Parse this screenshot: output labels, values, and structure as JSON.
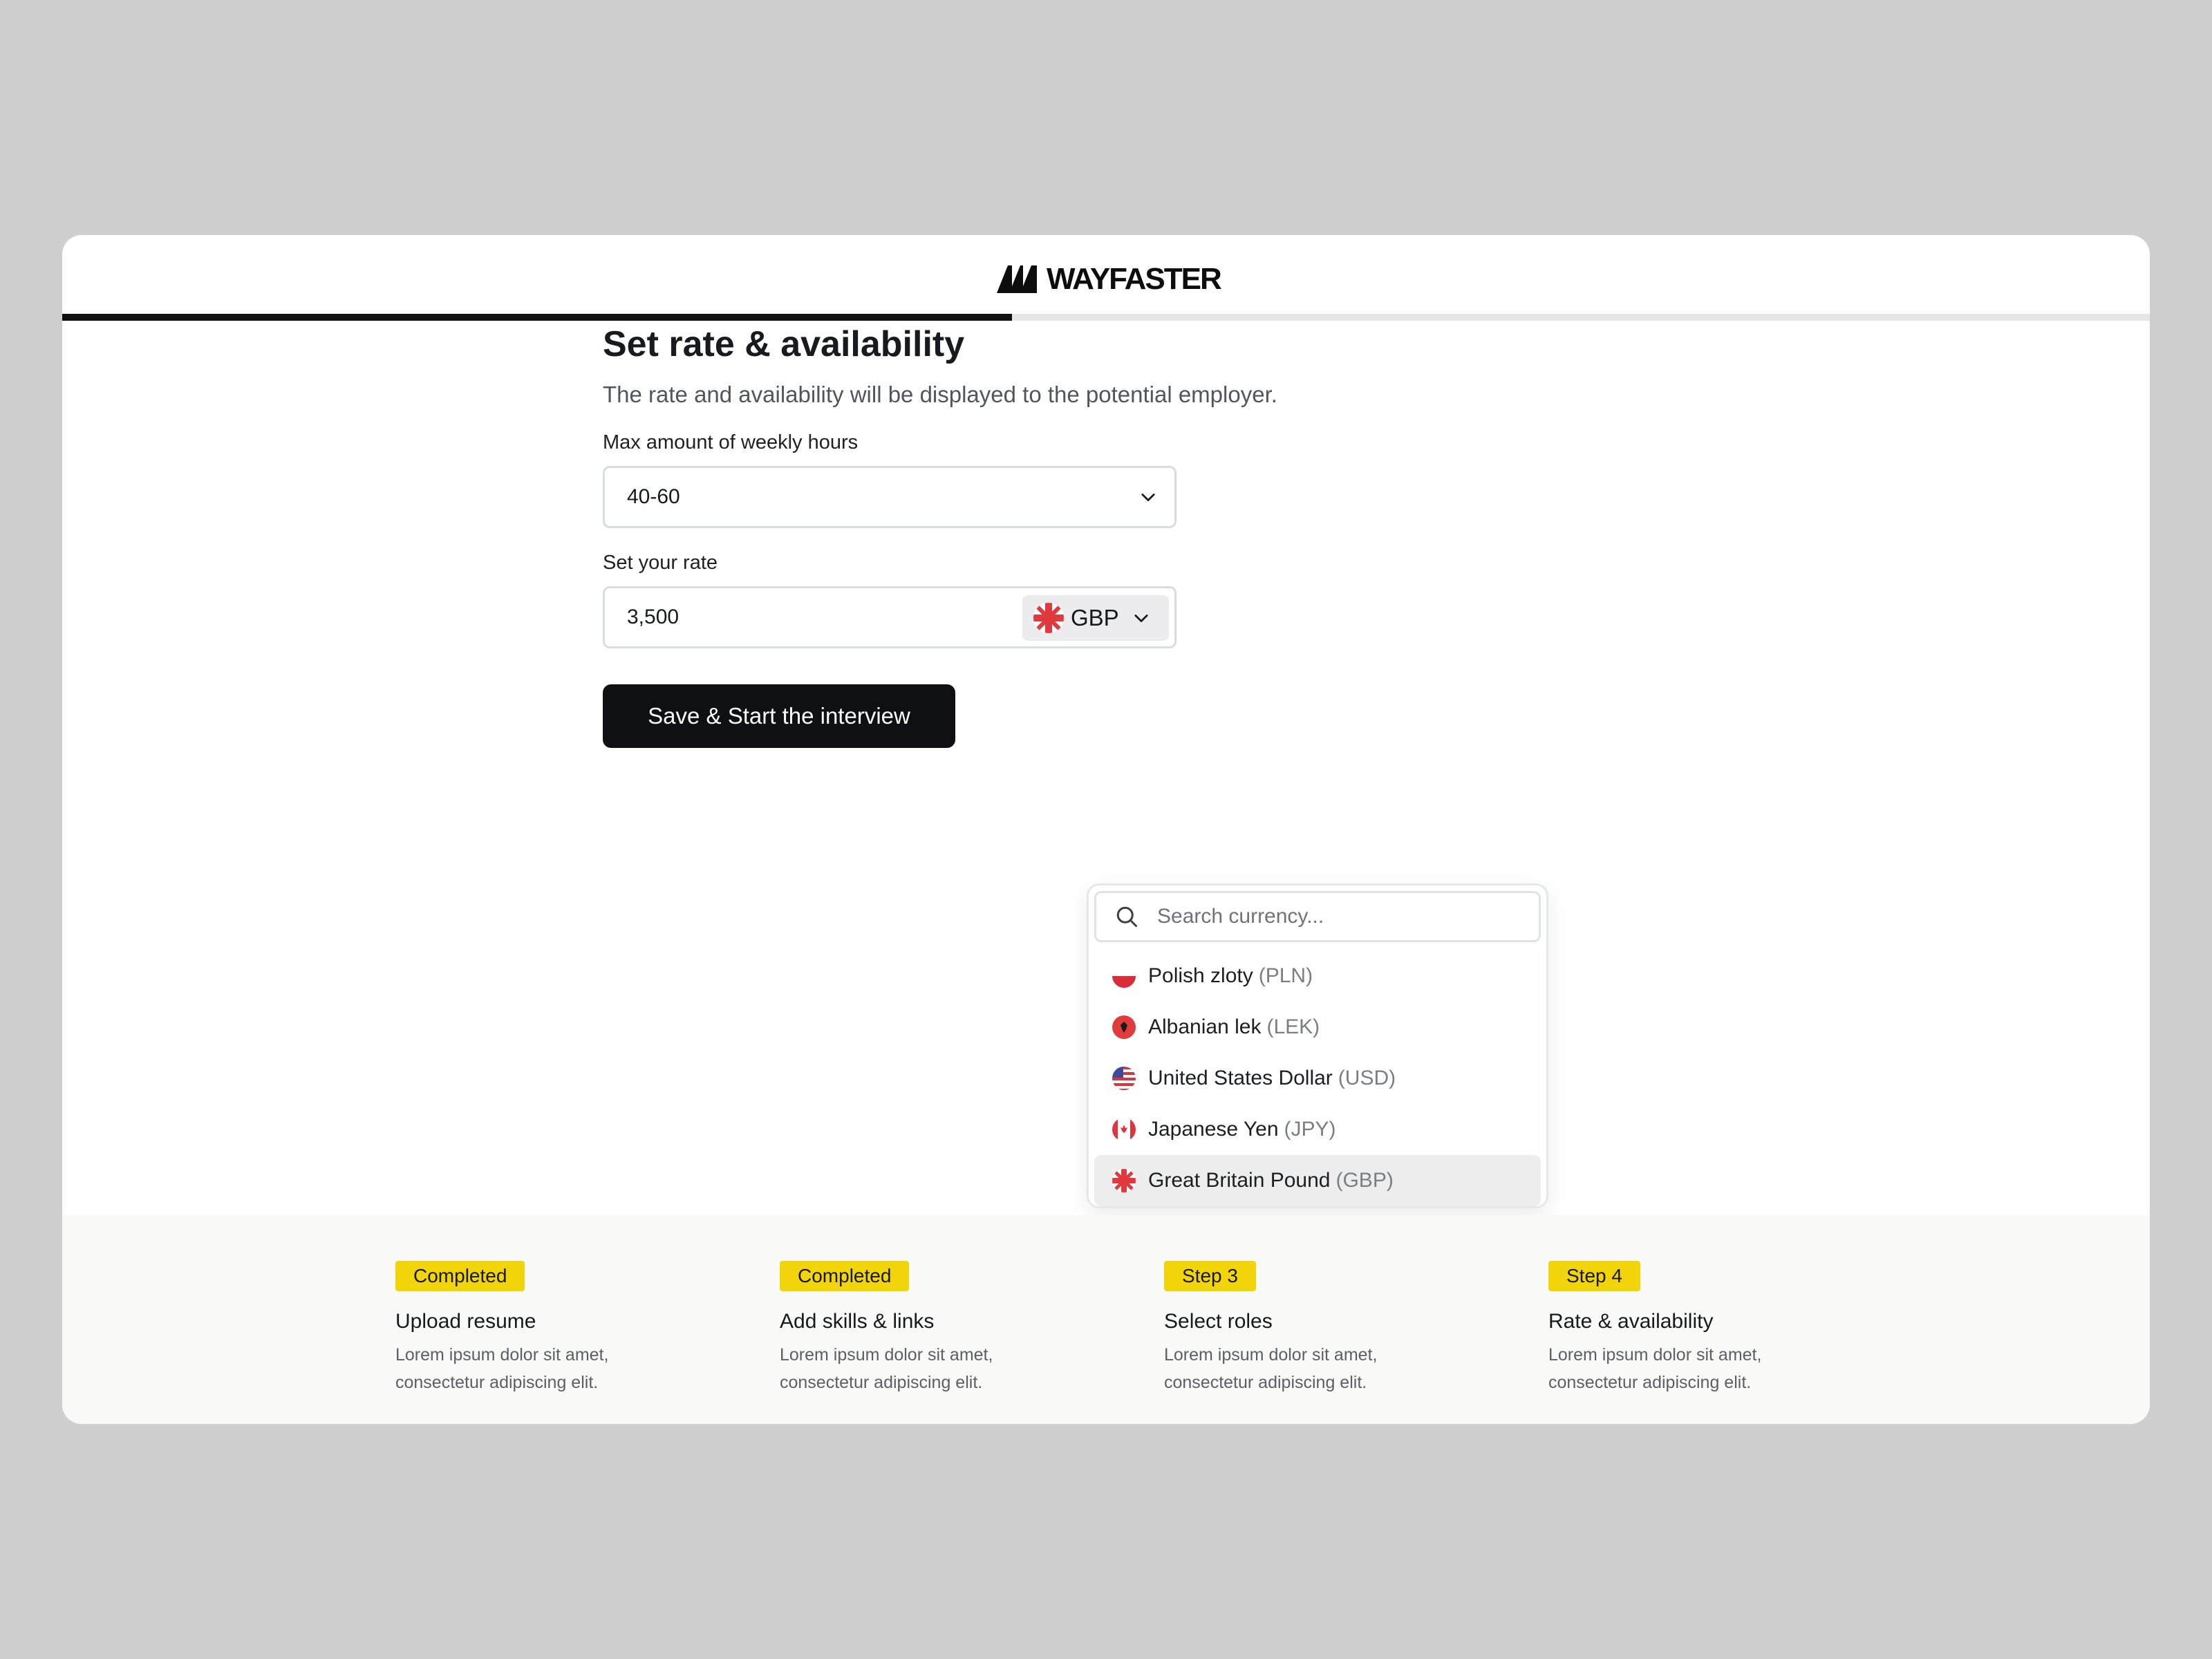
{
  "brand": {
    "name": "WAYFASTER"
  },
  "progress": {
    "percent": 45.5
  },
  "form": {
    "title": "Set rate & availability",
    "subtitle": "The rate and availability will be displayed to the potential employer.",
    "hours_label": "Max amount of weekly hours",
    "hours_value": "40-60",
    "rate_label": "Set your rate",
    "rate_value": "3,500",
    "currency_code": "GBP",
    "save_label": "Save & Start the interview"
  },
  "currency_dropdown": {
    "search_placeholder": "Search currency...",
    "options": [
      {
        "name": "Polish zloty",
        "code": "(PLN)",
        "flag": "poland-flag-icon",
        "selected": false
      },
      {
        "name": "Albanian lek",
        "code": "(LEK)",
        "flag": "albania-flag-icon",
        "selected": false
      },
      {
        "name": "United States Dollar",
        "code": "(USD)",
        "flag": "usa-flag-icon",
        "selected": false
      },
      {
        "name": "Japanese Yen",
        "code": "(JPY)",
        "flag": "canada-flag-icon",
        "selected": false
      },
      {
        "name": "Great Britain Pound",
        "code": "(GBP)",
        "flag": "uk-flag-icon",
        "selected": true
      }
    ]
  },
  "steps": [
    {
      "badge": "Completed",
      "title": "Upload resume",
      "desc1": "Lorem ipsum dolor sit amet,",
      "desc2": "consectetur adipiscing elit."
    },
    {
      "badge": "Completed",
      "title": "Add skills & links",
      "desc1": "Lorem ipsum dolor sit amet,",
      "desc2": "consectetur adipiscing elit."
    },
    {
      "badge": "Step 3",
      "title": "Select roles",
      "desc1": "Lorem ipsum dolor sit amet,",
      "desc2": "consectetur adipiscing elit."
    },
    {
      "badge": "Step 4",
      "title": "Rate & availability",
      "desc1": "Lorem ipsum dolor sit amet,",
      "desc2": "consectetur adipiscing elit."
    }
  ],
  "colors": {
    "accent_badge": "#f2d40a",
    "primary_button": "#0e1014",
    "progress_fill": "#0f1013"
  }
}
